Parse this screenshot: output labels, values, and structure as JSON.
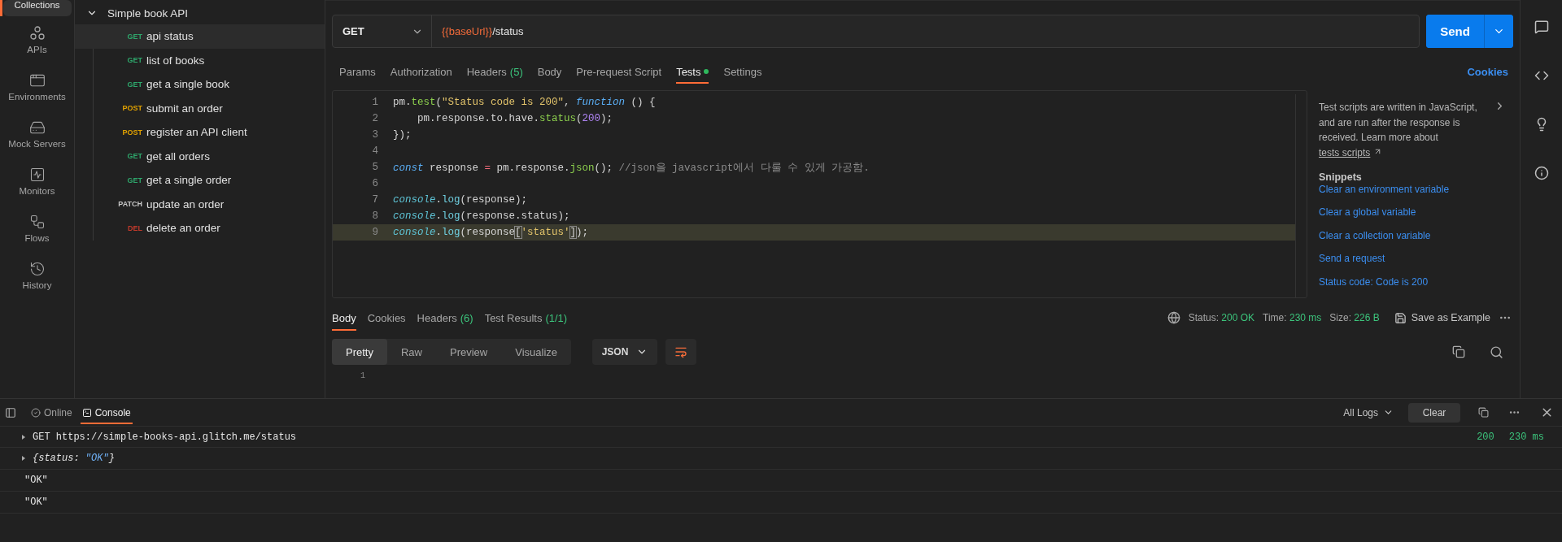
{
  "nav_rail": {
    "items": [
      {
        "label": "Collections",
        "selected": true
      },
      {
        "label": "APIs",
        "selected": false
      },
      {
        "label": "Environments",
        "selected": false
      },
      {
        "label": "Mock Servers",
        "selected": false
      },
      {
        "label": "Monitors",
        "selected": false
      },
      {
        "label": "Flows",
        "selected": false
      },
      {
        "label": "History",
        "selected": false
      }
    ]
  },
  "collection": {
    "name": "Simple book API",
    "expanded": true,
    "requests": [
      {
        "method": "GET",
        "name": "api status",
        "selected": true
      },
      {
        "method": "GET",
        "name": "list of books",
        "selected": false
      },
      {
        "method": "GET",
        "name": "get a single book",
        "selected": false
      },
      {
        "method": "POST",
        "name": "submit an order",
        "selected": false
      },
      {
        "method": "POST",
        "name": "register an API client",
        "selected": false
      },
      {
        "method": "GET",
        "name": "get all orders",
        "selected": false
      },
      {
        "method": "GET",
        "name": "get a single order",
        "selected": false
      },
      {
        "method": "PATCH",
        "name": "update an order",
        "selected": false
      },
      {
        "method": "DEL",
        "name": "delete an order",
        "selected": false
      }
    ]
  },
  "request": {
    "method": "GET",
    "url_variable": "{{baseUrl}}",
    "url_path": "/status",
    "send_label": "Send"
  },
  "request_tabs": [
    {
      "label": "Params",
      "selected": false
    },
    {
      "label": "Authorization",
      "selected": false
    },
    {
      "label": "Headers",
      "count": "(5)",
      "selected": false
    },
    {
      "label": "Body",
      "selected": false
    },
    {
      "label": "Pre-request Script",
      "selected": false
    },
    {
      "label": "Tests",
      "selected": true,
      "has_content": true
    },
    {
      "label": "Settings",
      "selected": false
    }
  ],
  "cookies_link": "Cookies",
  "editor": {
    "lines": [
      {
        "number": "1",
        "current": false,
        "tokens": [
          {
            "kind": "plain",
            "text": "pm."
          },
          {
            "kind": "call",
            "text": "test"
          },
          {
            "kind": "plain",
            "text": "("
          },
          {
            "kind": "string",
            "text": "\"Status code is 200\""
          },
          {
            "kind": "plain",
            "text": ", "
          },
          {
            "kind": "keyword",
            "text": "function"
          },
          {
            "kind": "plain",
            "text": " () {"
          }
        ]
      },
      {
        "number": "2",
        "current": false,
        "tokens": [
          {
            "kind": "plain",
            "text": "    pm.response.to.have."
          },
          {
            "kind": "call",
            "text": "status"
          },
          {
            "kind": "plain",
            "text": "("
          },
          {
            "kind": "number",
            "text": "200"
          },
          {
            "kind": "plain",
            "text": ");"
          }
        ]
      },
      {
        "number": "3",
        "current": false,
        "tokens": [
          {
            "kind": "plain",
            "text": "});"
          }
        ]
      },
      {
        "number": "4",
        "current": false
      },
      {
        "number": "5",
        "current": false,
        "tokens": [
          {
            "kind": "keyword",
            "text": "const"
          },
          {
            "kind": "plain",
            "text": " response "
          },
          {
            "kind": "operator",
            "text": "="
          },
          {
            "kind": "plain",
            "text": " pm.response."
          },
          {
            "kind": "call",
            "text": "json"
          },
          {
            "kind": "plain",
            "text": "(); "
          },
          {
            "kind": "comment",
            "text": "//json을 javascript에서 다룰 수 있게 가공함."
          }
        ]
      },
      {
        "number": "6",
        "current": false
      },
      {
        "number": "7",
        "current": false,
        "tokens": [
          {
            "kind": "object",
            "text": "console"
          },
          {
            "kind": "plain",
            "text": "."
          },
          {
            "kind": "log",
            "text": "log"
          },
          {
            "kind": "plain",
            "text": "(response);"
          }
        ]
      },
      {
        "number": "8",
        "current": false,
        "tokens": [
          {
            "kind": "object",
            "text": "console"
          },
          {
            "kind": "plain",
            "text": "."
          },
          {
            "kind": "log",
            "text": "log"
          },
          {
            "kind": "plain",
            "text": "(response.status);"
          }
        ]
      },
      {
        "number": "9",
        "current": true,
        "tokens": [
          {
            "kind": "object",
            "text": "console"
          },
          {
            "kind": "plain",
            "text": "."
          },
          {
            "kind": "log",
            "text": "log"
          },
          {
            "kind": "plain",
            "text": "(response"
          },
          {
            "kind": "bracket",
            "text": "["
          },
          {
            "kind": "string",
            "text": "'status'"
          },
          {
            "kind": "bracket",
            "text": "]"
          },
          {
            "kind": "plain",
            "text": ");"
          }
        ]
      }
    ]
  },
  "help_panel": {
    "text": "Test scripts are written in JavaScript, and are run after the response is received. Learn more about",
    "link": "tests scripts",
    "snippets_title": "Snippets",
    "snippets": [
      "Clear an environment variable",
      "Clear a global variable",
      "Clear a collection variable",
      "Send a request",
      "Status code: Code is 200"
    ]
  },
  "response": {
    "tabs": [
      {
        "label": "Body",
        "selected": true
      },
      {
        "label": "Cookies",
        "selected": false
      },
      {
        "label": "Headers",
        "count": "(6)",
        "selected": false
      },
      {
        "label": "Test Results",
        "count": "(1/1)",
        "selected": false
      }
    ],
    "status_label": "Status:",
    "status": "200 OK",
    "time_label": "Time:",
    "time": "230 ms",
    "size_label": "Size:",
    "size": "226 B",
    "save_label": "Save as Example",
    "view_modes": [
      {
        "label": "Pretty",
        "selected": true
      },
      {
        "label": "Raw",
        "selected": false
      },
      {
        "label": "Preview",
        "selected": false
      },
      {
        "label": "Visualize",
        "selected": false
      }
    ],
    "format": "JSON",
    "line_number": "1"
  },
  "console_bar": {
    "tabs": [
      {
        "label": "Online",
        "selected": false
      },
      {
        "label": "Console",
        "selected": true
      }
    ],
    "filter": "All Logs",
    "clear_label": "Clear"
  },
  "console_entries": [
    {
      "kind": "request",
      "expanded": false,
      "method": "GET",
      "url": "https://simple-books-api.glitch.me/status",
      "status": "200",
      "time": "230 ms"
    },
    {
      "kind": "object",
      "expanded": false,
      "open": "{status: ",
      "value": "\"OK\"",
      "close": "}"
    },
    {
      "kind": "value",
      "text": "\"OK\""
    },
    {
      "kind": "value",
      "text": "\"OK\""
    }
  ]
}
